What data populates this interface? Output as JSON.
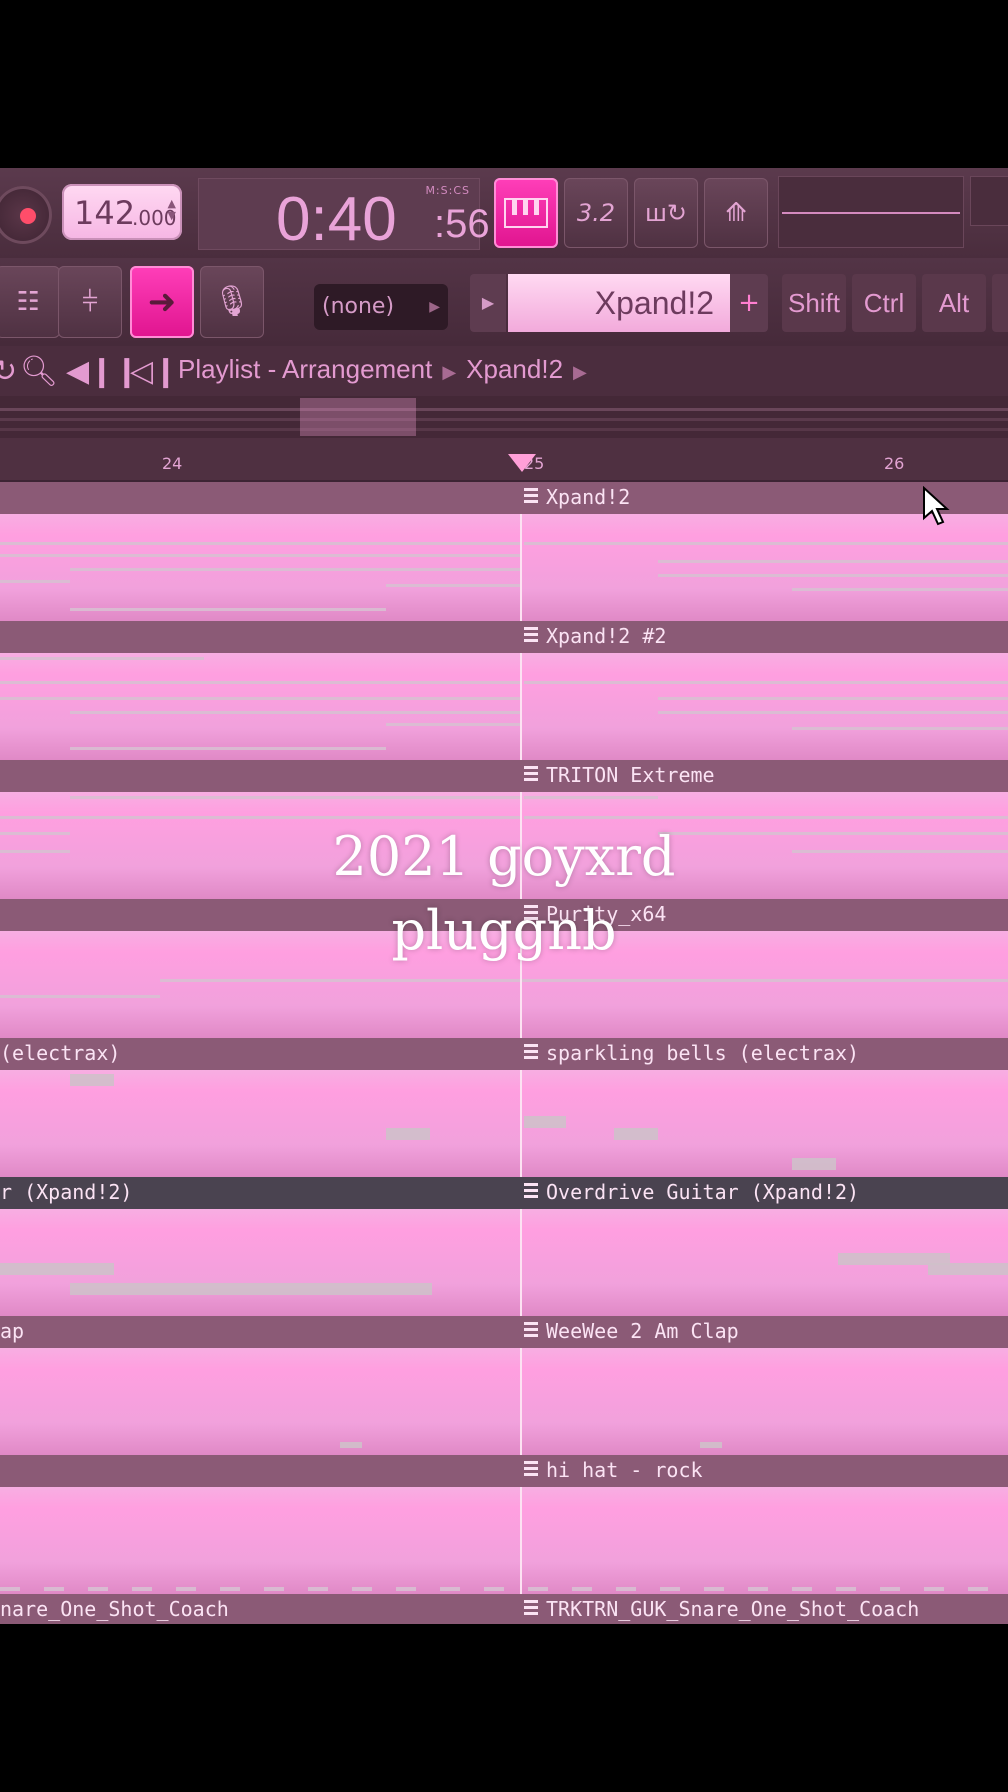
{
  "transport": {
    "tempo_int": "142",
    "tempo_dec": ".000",
    "time_main": "0:40",
    "time_cs": ":56",
    "time_format": "M:S:CS"
  },
  "toolbar": {
    "snap_label": "3.2",
    "pattern_select": "(none)",
    "channel_name": "Xpand!2",
    "keys": [
      "Shift",
      "Ctrl",
      "Alt"
    ]
  },
  "playlist": {
    "title": "Playlist - Arrangement",
    "current": "Xpand!2"
  },
  "ruler": {
    "bars": [
      "24",
      "25",
      "26"
    ]
  },
  "tracks": [
    {
      "left_label": "",
      "right_label": "Xpand!2"
    },
    {
      "left_label": "",
      "right_label": "Xpand!2 #2"
    },
    {
      "left_label": "",
      "right_label": "TRITON Extreme"
    },
    {
      "left_label": "",
      "right_label": "Purity_x64"
    },
    {
      "left_label": "(electrax)",
      "right_label": "sparkling bells (electrax)"
    },
    {
      "left_label": "r (Xpand!2)",
      "right_label": "Overdrive Guitar (Xpand!2)"
    },
    {
      "left_label": "ap",
      "right_label": "WeeWee 2 Am Clap"
    },
    {
      "left_label": "",
      "right_label": "hi hat - rock"
    },
    {
      "left_label": "nare_One_Shot_Coach",
      "right_label": "TRKTRN_GUK_Snare_One_Shot_Coach"
    }
  ],
  "watermark": {
    "line1": "2021 goyxrd",
    "line2": "pluggnb"
  },
  "colors": {
    "accent": "#ff3fb9",
    "clip": "#f7aee2",
    "header": "#8b5a76"
  }
}
